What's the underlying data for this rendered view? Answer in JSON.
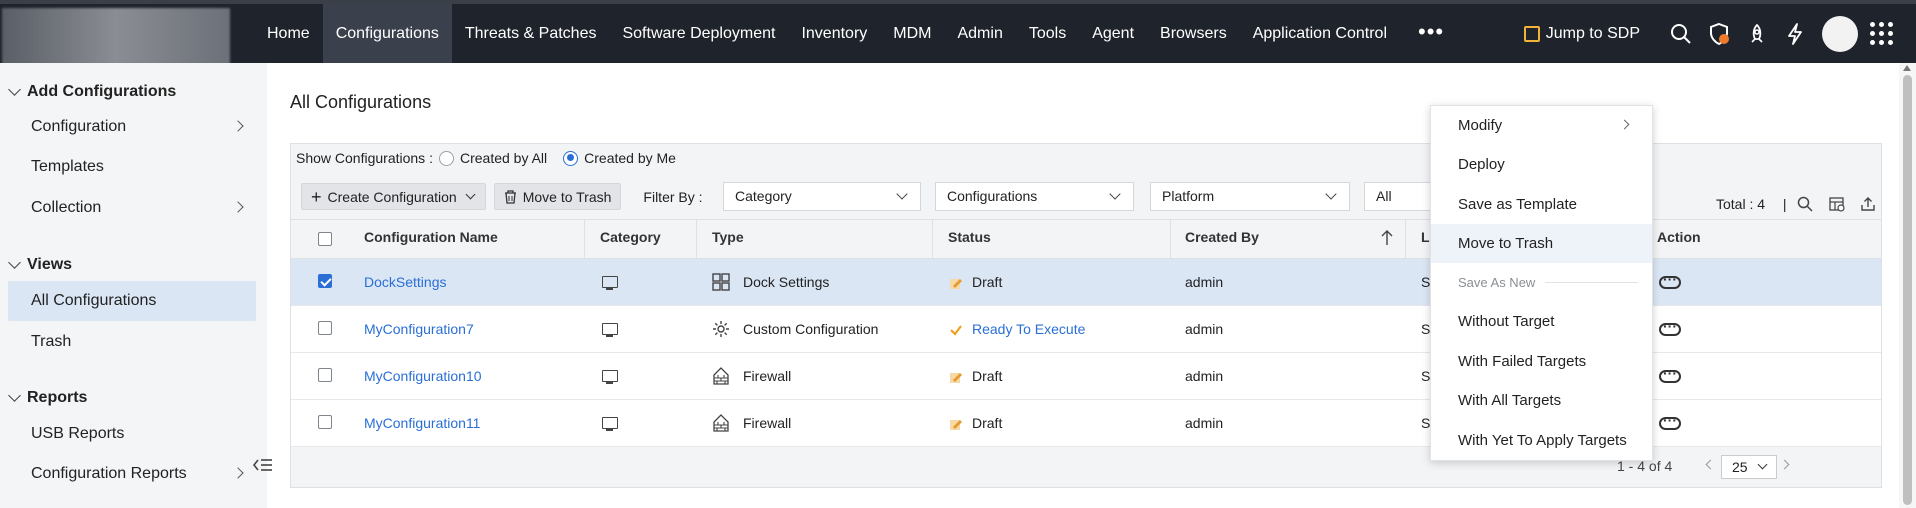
{
  "nav": {
    "items": [
      "Home",
      "Configurations",
      "Threats & Patches",
      "Software Deployment",
      "Inventory",
      "MDM",
      "Admin",
      "Tools",
      "Agent",
      "Browsers",
      "Application Control"
    ],
    "more": "•••",
    "jump_label": "Jump to SDP",
    "icons": [
      "search-icon",
      "shield-icon",
      "rocket-icon",
      "lightning-icon",
      "avatar",
      "app-grid-icon"
    ]
  },
  "sidebar": {
    "sections": [
      {
        "title": "Add Configurations",
        "items": [
          "Configuration",
          "Templates",
          "Collection"
        ]
      },
      {
        "title": "Views",
        "items": [
          "All Configurations",
          "Trash"
        ]
      },
      {
        "title": "Reports",
        "items": [
          "USB Reports",
          "Configuration Reports"
        ]
      }
    ]
  },
  "page": {
    "title": "All Configurations",
    "show_label": "Show Configurations :",
    "radio_all": "Created by All",
    "radio_me": "Created by Me",
    "create_btn": "Create Configuration",
    "trash_btn": "Move to Trash",
    "filter_label": "Filter By :",
    "filters": [
      "Category",
      "Configurations",
      "Platform",
      "All Status"
    ],
    "total": "Total : 4",
    "total_sep": "|"
  },
  "table": {
    "columns": [
      "Configuration Name",
      "Category",
      "Type",
      "Status",
      "Created By",
      "L",
      "Action"
    ],
    "rows": [
      {
        "name": "DockSettings",
        "type": "Dock Settings",
        "status": "Draft",
        "created_by": "admin",
        "l": "S",
        "selected": true
      },
      {
        "name": "MyConfiguration7",
        "type": "Custom Configuration",
        "status": "Ready To Execute",
        "created_by": "admin",
        "l": "S",
        "selected": false
      },
      {
        "name": "MyConfiguration10",
        "type": "Firewall",
        "status": "Draft",
        "created_by": "admin",
        "l": "S",
        "selected": false
      },
      {
        "name": "MyConfiguration11",
        "type": "Firewall",
        "status": "Draft",
        "created_by": "admin",
        "l": "S",
        "selected": false
      }
    ]
  },
  "pager": {
    "range": "1 - 4 of 4",
    "per_page": "25"
  },
  "context_menu": {
    "items": [
      "Modify",
      "Deploy",
      "Save as Template",
      "Move to Trash"
    ],
    "sub_header": "Save As New",
    "sub_items": [
      "Without Target",
      "With Failed Targets",
      "With All Targets",
      "With Yet To Apply Targets"
    ]
  },
  "colors": {
    "nav_bg": "#1f232b",
    "accent": "#2a6fd6",
    "selected_row": "#dbe6f5",
    "status_ready": "#2a6fd6"
  }
}
